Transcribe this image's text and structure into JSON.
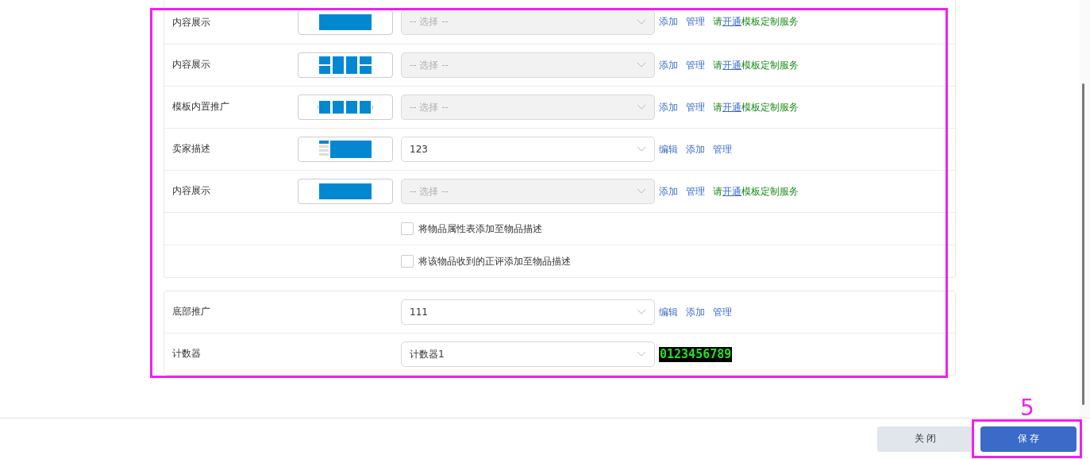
{
  "sections": [
    {
      "rows": [
        {
          "kind": "select",
          "label": "内容展示",
          "thumbnail": {
            "kind": "banner"
          },
          "select": {
            "placeholder": "-- 选择 --",
            "disabled": true
          },
          "links": [
            "添加",
            "管理"
          ],
          "service_note": {
            "before": "请",
            "link": "开通",
            "after": "模板定制服务"
          }
        },
        {
          "kind": "select",
          "label": "内容展示",
          "thumbnail": {
            "kind": "grid"
          },
          "select": {
            "placeholder": "-- 选择 --",
            "disabled": true
          },
          "links": [
            "添加",
            "管理"
          ],
          "service_note": {
            "before": "请",
            "link": "开通",
            "after": "模板定制服务"
          }
        },
        {
          "kind": "select",
          "label": "模板内置推广",
          "thumbnail": {
            "kind": "carousel"
          },
          "select": {
            "placeholder": "-- 选择 --",
            "disabled": true
          },
          "links": [
            "添加",
            "管理"
          ],
          "service_note": {
            "before": "请",
            "link": "开通",
            "after": "模板定制服务"
          }
        },
        {
          "kind": "select",
          "label": "卖家描述",
          "thumbnail": {
            "kind": "sidebar"
          },
          "select": {
            "value": "123",
            "disabled": false
          },
          "links": [
            "编辑",
            "添加",
            "管理"
          ]
        },
        {
          "kind": "select",
          "label": "内容展示",
          "thumbnail": {
            "kind": "banner"
          },
          "select": {
            "placeholder": "-- 选择 --",
            "disabled": true
          },
          "links": [
            "添加",
            "管理"
          ],
          "service_note": {
            "before": "请",
            "link": "开通",
            "after": "模板定制服务"
          }
        },
        {
          "kind": "checkbox",
          "text": "将物品属性表添加至物品描述",
          "checked": false
        },
        {
          "kind": "checkbox",
          "text": "将该物品收到的正评添加至物品描述",
          "checked": false
        }
      ]
    },
    {
      "rows": [
        {
          "kind": "select",
          "label": "底部推广",
          "select": {
            "value": "111",
            "disabled": false
          },
          "links": [
            "编辑",
            "添加",
            "管理"
          ]
        },
        {
          "kind": "select",
          "label": "计数器",
          "select": {
            "value": "计数器1",
            "disabled": false
          },
          "counter": "0123456789"
        }
      ]
    }
  ],
  "footer": {
    "buttons": [
      {
        "label": "关 闭",
        "kind": "secondary"
      },
      {
        "label": "保 存",
        "kind": "primary"
      }
    ]
  },
  "annotation": {
    "step_label": "5"
  }
}
